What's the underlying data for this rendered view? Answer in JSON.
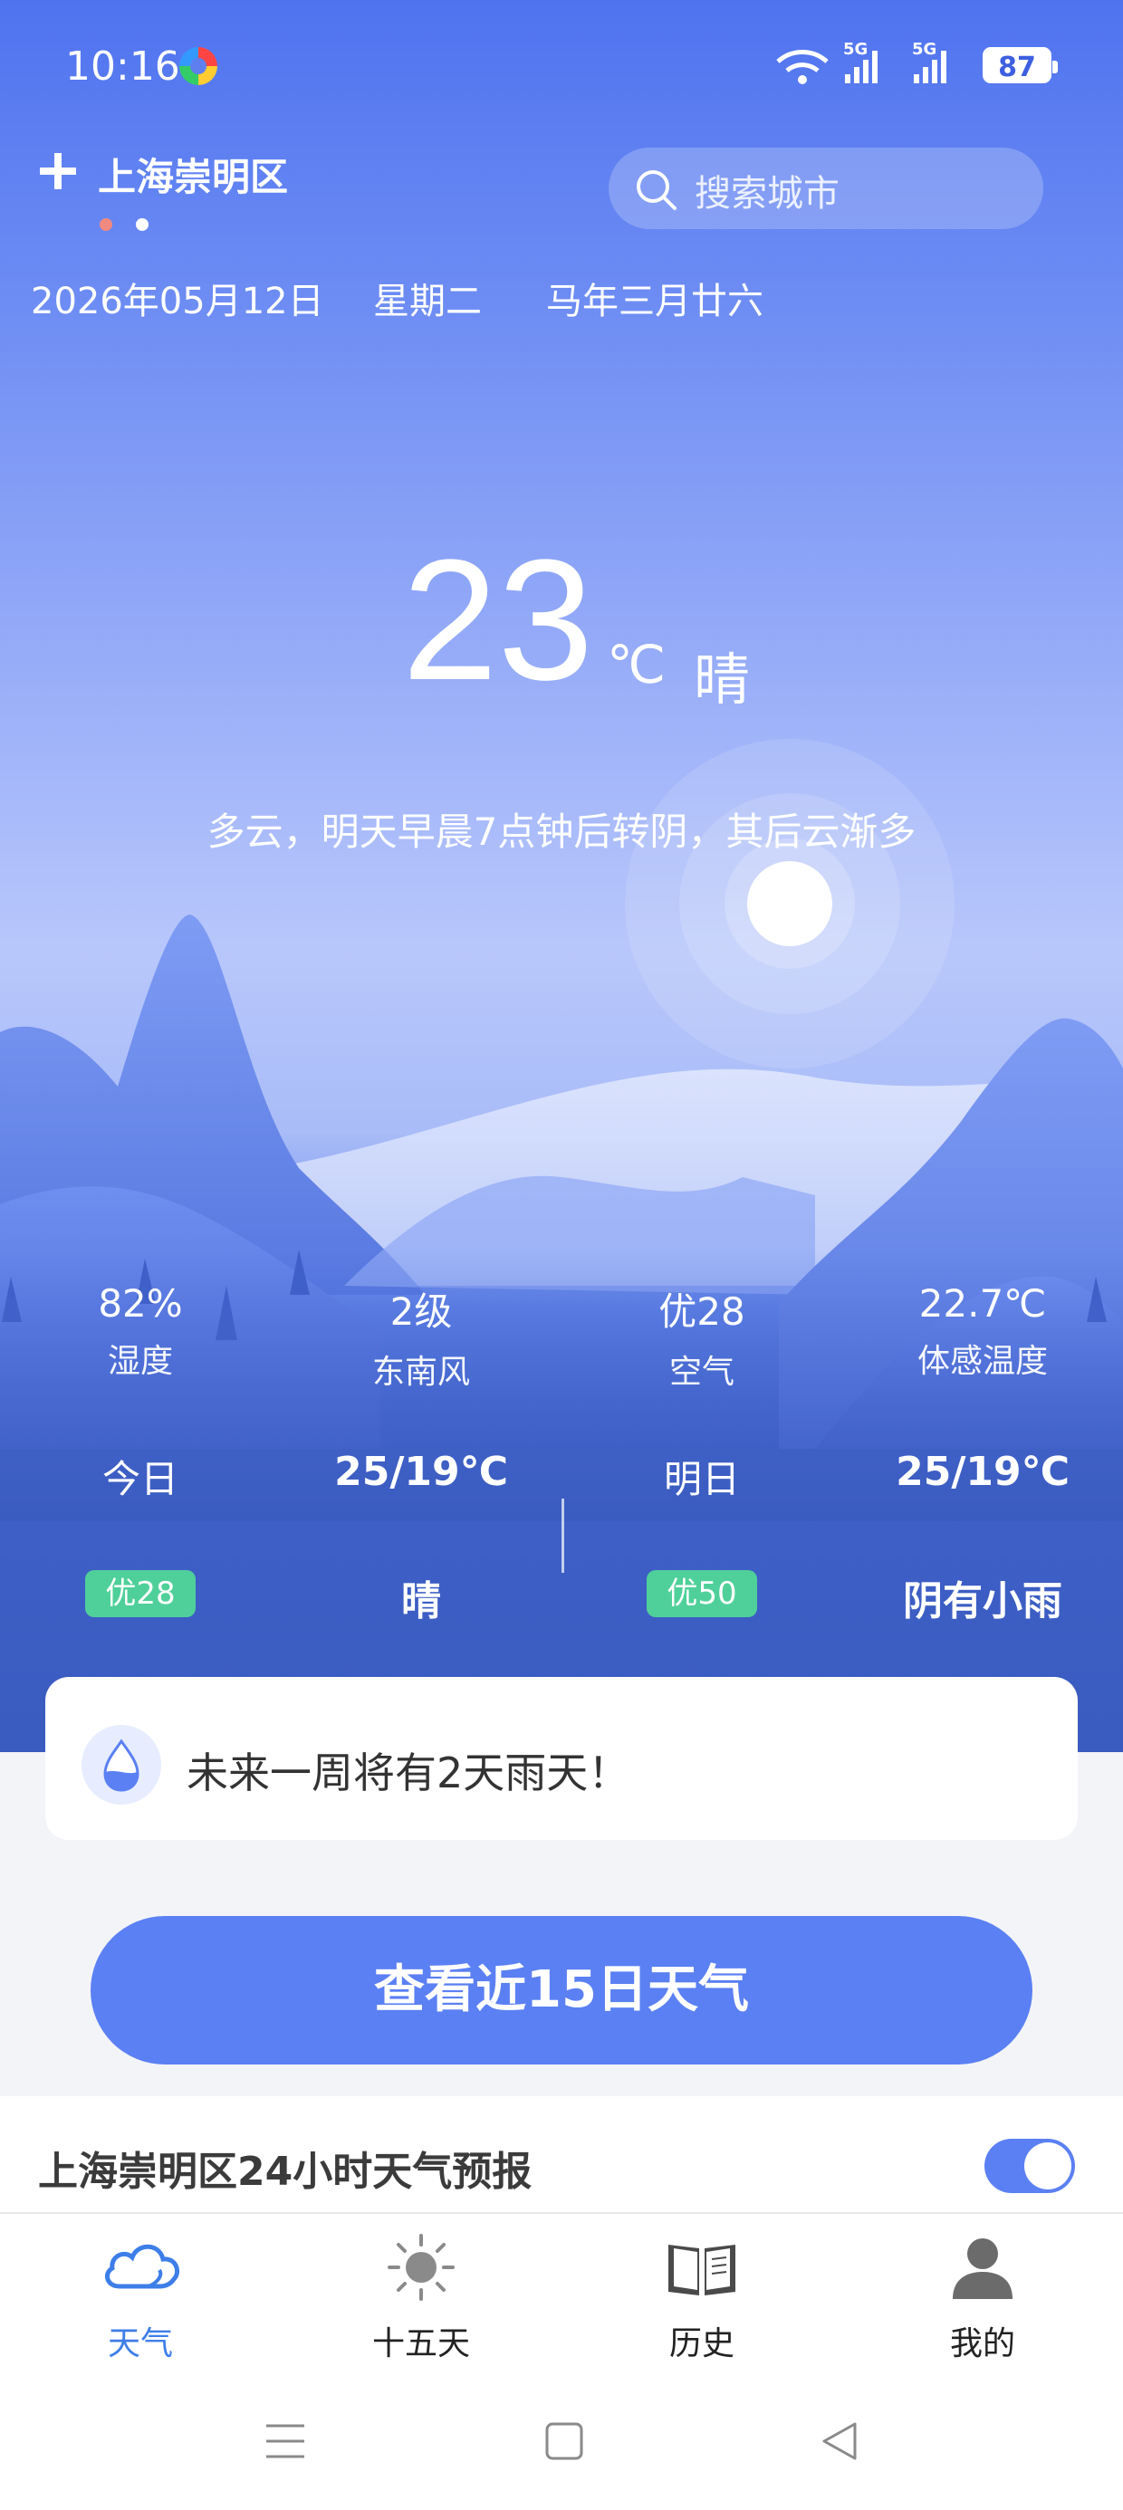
{
  "status_bar": {
    "time": "10:16",
    "network_1": "5G",
    "network_2": "5G",
    "battery": "87"
  },
  "header": {
    "city": "上海崇明区",
    "search_placeholder": "搜索城市"
  },
  "date_row": {
    "date": "2026年05月12日",
    "weekday": "星期二",
    "lunar": "马年三月廿六"
  },
  "current": {
    "temperature": "23",
    "unit": "℃",
    "condition": "晴",
    "description": "多云，明天早晨7点钟后转阴，其后云渐多"
  },
  "stats": [
    {
      "value": "82%",
      "label": "湿度"
    },
    {
      "value": "2级",
      "label": "东南风"
    },
    {
      "value": "优28",
      "label": "空气"
    },
    {
      "value": "22.7℃",
      "label": "体感温度"
    }
  ],
  "forecast": {
    "today": {
      "label": "今日",
      "temp": "25/19℃",
      "aqi": "优28",
      "condition": "晴"
    },
    "tomorrow": {
      "label": "明日",
      "temp": "25/19℃",
      "aqi": "优50",
      "condition": "阴有小雨"
    }
  },
  "alert": {
    "text": "未来一周将有2天雨天！",
    "icon": "water-drop-icon"
  },
  "cta": {
    "label": "查看近15日天气"
  },
  "hourly_section": {
    "title": "上海崇明区24小时天气预报",
    "toggle_on": true
  },
  "tabs": [
    {
      "label": "天气",
      "icon": "cloud-icon",
      "active": true
    },
    {
      "label": "十五天",
      "icon": "sun-icon",
      "active": false
    },
    {
      "label": "历史",
      "icon": "book-icon",
      "active": false
    },
    {
      "label": "我的",
      "icon": "user-icon",
      "active": false
    }
  ],
  "colors": {
    "accent": "#5b80f3",
    "aqi_badge": "#4fd09a",
    "active_tab": "#3d7ee8"
  }
}
